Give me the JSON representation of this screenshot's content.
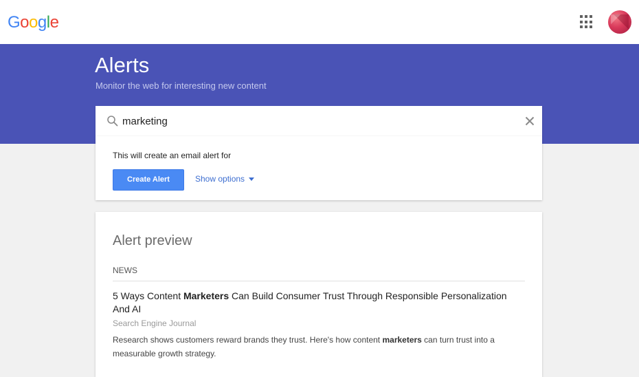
{
  "header": {
    "logo_letters": [
      {
        "char": "G",
        "color": "#4285f4"
      },
      {
        "char": "o",
        "color": "#ea4335"
      },
      {
        "char": "o",
        "color": "#fbbc05"
      },
      {
        "char": "g",
        "color": "#4285f4"
      },
      {
        "char": "l",
        "color": "#34a853"
      },
      {
        "char": "e",
        "color": "#ea4335"
      }
    ],
    "apps_icon": "apps-grid-icon",
    "avatar_icon": "profile-avatar"
  },
  "banner": {
    "title": "Alerts",
    "subtitle": "Monitor the web for interesting new content",
    "color": "#4a53b6"
  },
  "search": {
    "value": "marketing",
    "icon": "search-icon",
    "clear_icon": "close-icon"
  },
  "create": {
    "description": "This will create an email alert for",
    "button_label": "Create Alert",
    "show_options_label": "Show options",
    "button_color": "#4a8af4"
  },
  "preview": {
    "title": "Alert preview",
    "section": "NEWS",
    "article": {
      "title_parts": [
        "5 Ways Content ",
        "Marketers",
        " Can Build Consumer Trust Through Responsible Personalization And AI"
      ],
      "source": "Search Engine Journal",
      "snippet_parts": [
        "Research shows customers reward brands they trust. Here's how content ",
        "marketers",
        " can turn trust into a measurable growth strategy."
      ]
    }
  }
}
